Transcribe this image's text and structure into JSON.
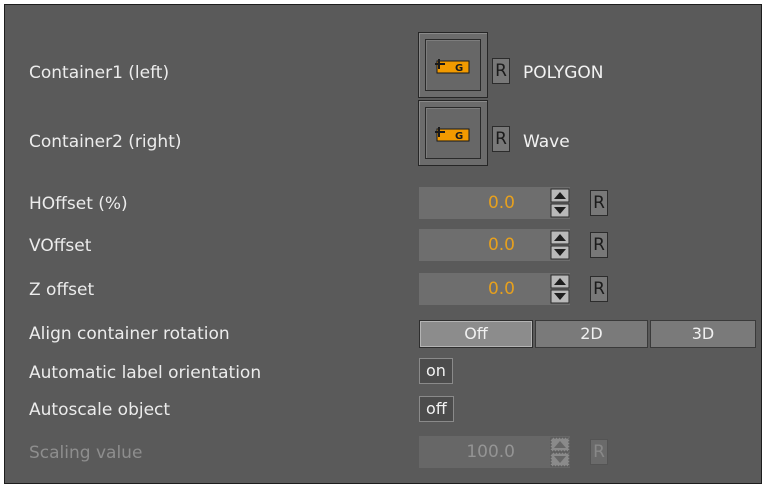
{
  "rows": {
    "container1": {
      "label": "Container1 (left)",
      "name": "POLYGON",
      "reset": "R"
    },
    "container2": {
      "label": "Container2 (right)",
      "name": "Wave",
      "reset": "R"
    },
    "hoffset": {
      "label": "HOffset (%)",
      "value": "0.0",
      "reset": "R"
    },
    "voffset": {
      "label": "VOffset",
      "value": "0.0",
      "reset": "R"
    },
    "zoffset": {
      "label": "Z offset",
      "value": "0.0",
      "reset": "R"
    },
    "align_rotation": {
      "label": "Align container rotation",
      "options": [
        "Off",
        "2D",
        "3D"
      ],
      "selected": "Off"
    },
    "auto_label": {
      "label": "Automatic label orientation",
      "value": "on"
    },
    "autoscale": {
      "label": "Autoscale object",
      "value": "off"
    },
    "scaling": {
      "label": "Scaling value",
      "value": "100.0",
      "reset": "R",
      "disabled": true
    }
  },
  "icons": {
    "container_icon": "group-container-icon",
    "spinner": "up-down-spinner-icon"
  },
  "colors": {
    "panel": "#5a5a5a",
    "value_text": "#e6a01e",
    "icon_fill": "#f29a00"
  }
}
